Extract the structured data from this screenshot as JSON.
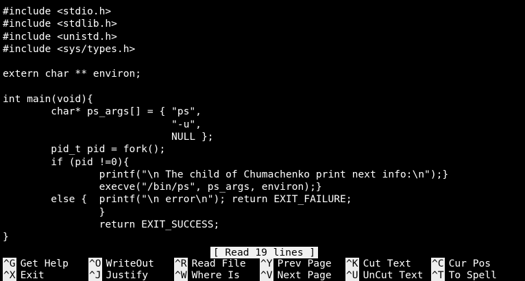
{
  "editor": {
    "lines": [
      "#include <stdio.h>",
      "#include <stdlib.h>",
      "#include <unistd.h>",
      "#include <sys/types.h>",
      "",
      "extern char ** environ;",
      "",
      "int main(void){",
      "        char* ps_args[] = { \"ps\",",
      "                            \"-u\",",
      "                            NULL };",
      "        pid_t pid = fork();",
      "        if (pid !=0){",
      "                printf(\"\\n The child of Chumachenko print next info:\\n\");}",
      "                execve(\"/bin/ps\", ps_args, environ);}",
      "        else {  printf(\"\\n error\\n\"); return EXIT_FAILURE;",
      "                }",
      "                return EXIT_SUCCESS;",
      "}"
    ]
  },
  "status": {
    "message": "[ Read 19 lines ]"
  },
  "shortcuts": {
    "row1": [
      {
        "key": "^G",
        "label": "Get Help"
      },
      {
        "key": "^O",
        "label": "WriteOut"
      },
      {
        "key": "^R",
        "label": "Read File"
      },
      {
        "key": "^Y",
        "label": "Prev Page"
      },
      {
        "key": "^K",
        "label": "Cut Text"
      },
      {
        "key": "^C",
        "label": "Cur Pos"
      }
    ],
    "row2": [
      {
        "key": "^X",
        "label": "Exit"
      },
      {
        "key": "^J",
        "label": "Justify"
      },
      {
        "key": "^W",
        "label": "Where Is"
      },
      {
        "key": "^V",
        "label": "Next Page"
      },
      {
        "key": "^U",
        "label": "UnCut Text"
      },
      {
        "key": "^T",
        "label": "To Spell"
      }
    ]
  },
  "colors": {
    "background": "#000000",
    "text": "#ffffff",
    "highlight": "#eeeeee"
  }
}
